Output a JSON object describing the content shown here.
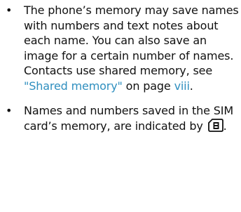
{
  "bullets": [
    {
      "text_before_link": "The phone’s memory may save names with numbers and text notes about each name. You can also save an image for a certain number of names. Contacts use shared memory, see ",
      "link_text": "\"Shared memory\"",
      "text_middle": " on page ",
      "page_link": "viii",
      "text_after": "."
    },
    {
      "text_before_icon": " Names and numbers saved in the SIM card’s memory, are indicated by ",
      "icon": "sim-card-icon",
      "text_after": "."
    }
  ],
  "colors": {
    "link": "#2f8fbf",
    "text": "#111111"
  }
}
